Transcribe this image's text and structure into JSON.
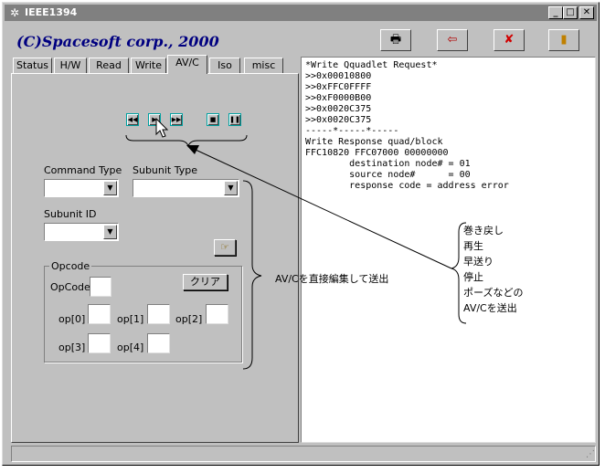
{
  "window": {
    "title": "IEEE1394",
    "minimize_glyph": "_",
    "maximize_glyph": "□",
    "close_glyph": "✕"
  },
  "brand": {
    "text": "(C)Spacesoft corp., 2000"
  },
  "toolbar": {
    "icons": [
      "document-transfer-icon",
      "import-icon",
      "clear-x-icon",
      "exit-door-icon"
    ],
    "glyphs": [
      "🖶",
      "⇦",
      "✘",
      "▮"
    ]
  },
  "tabs": [
    {
      "label": "Status"
    },
    {
      "label": "H/W"
    },
    {
      "label": "Read"
    },
    {
      "label": "Write"
    },
    {
      "label": "AV/C",
      "active": true
    },
    {
      "label": "Iso"
    },
    {
      "label": "misc"
    }
  ],
  "transport": {
    "glyphs": [
      "◀◀",
      "▶",
      "▶▶",
      "■",
      "❚❚"
    ],
    "icons": [
      "rewind-icon",
      "play-icon",
      "fast-forward-icon",
      "stop-icon",
      "pause-icon"
    ]
  },
  "form": {
    "command_type_label": "Command Type",
    "subunit_type_label": "Subunit Type",
    "subunit_id_label": "Subunit ID",
    "command_type_value": "",
    "subunit_type_value": "",
    "subunit_id_value": "",
    "send_icon_glyph": "☞",
    "opcode_group_label": "Opcode",
    "opcode_label": "OpCode",
    "clear_button": "クリア",
    "op_labels": [
      "op[0]",
      "op[1]",
      "op[2]",
      "op[3]",
      "op[4]"
    ],
    "op_values": [
      "",
      "",
      "",
      "",
      ""
    ],
    "opcode_value": ""
  },
  "log": {
    "lines": [
      "*Write Qquadlet Request*",
      ">>0x00010800",
      ">>0xFFC0FFFF",
      ">>0xF0000B00",
      ">>0x0020C375",
      ">>0x0020C375",
      "-----*-----*-----",
      "Write Response quad/block",
      "FFC10820 FFC07000 00000000",
      "        destination node# = 01",
      "        source node#      = 00",
      "        response code = address error"
    ]
  },
  "annotations": {
    "avc_direct": "AV/Cを直接編集して送出",
    "transport_notes": [
      "巻き戻し",
      "再生",
      "早送り",
      "停止",
      "ポーズなどの",
      "AV/Cを送出"
    ]
  },
  "colors": {
    "titlebar": "#808080",
    "brand": "#000080",
    "face": "#c0c0c0"
  }
}
